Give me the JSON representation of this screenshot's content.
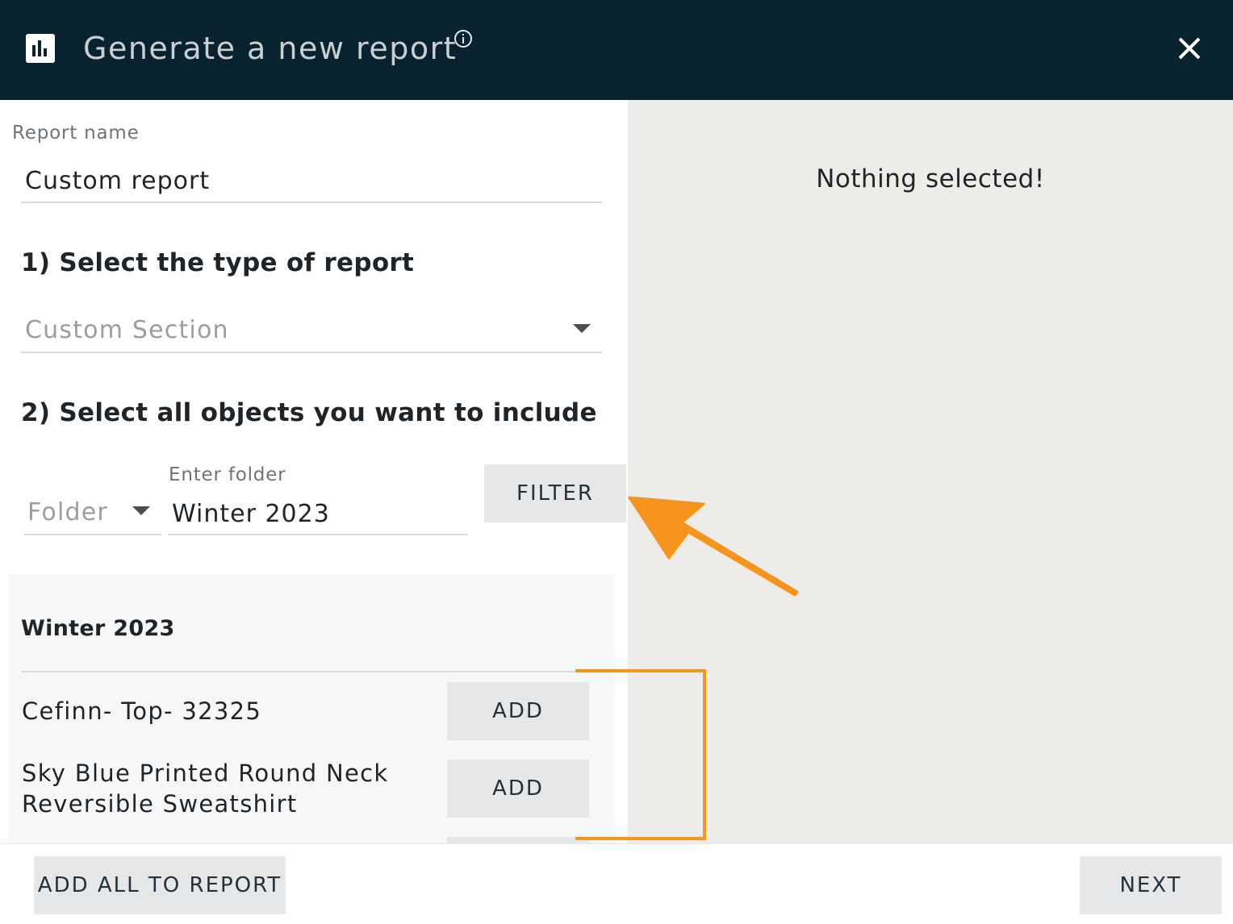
{
  "header": {
    "title": "Generate a new report",
    "logo_icon": "bar-chart-icon",
    "info_icon": "info-icon",
    "close_icon": "close-icon",
    "background": "#08232f"
  },
  "form": {
    "report_name_label": "Report name",
    "report_name_value": "Custom report",
    "step1_heading": "1) Select the type of report",
    "report_type_value": "Custom Section",
    "step2_heading": "2) Select all objects you want to include",
    "folder_select_value": "Folder",
    "folder_input_label": "Enter folder",
    "folder_input_value": "Winter 2023",
    "filter_button": "FILTER"
  },
  "object_list": {
    "title": "Winter 2023",
    "items": [
      {
        "label": "Cefinn- Top- 32325",
        "button": "ADD"
      },
      {
        "label_line1": "Sky Blue Printed Round Neck",
        "label_line2": "Reversible Sweatshirt",
        "button": "ADD"
      }
    ]
  },
  "preview": {
    "empty_message": "Nothing selected!",
    "background": "#edece8"
  },
  "footer": {
    "add_all_button": "ADD ALL TO REPORT",
    "next_button": "NEXT"
  },
  "annotations": {
    "color": "#f7941d",
    "arrow_target": "filter-button",
    "bracket_target": "add-buttons"
  }
}
